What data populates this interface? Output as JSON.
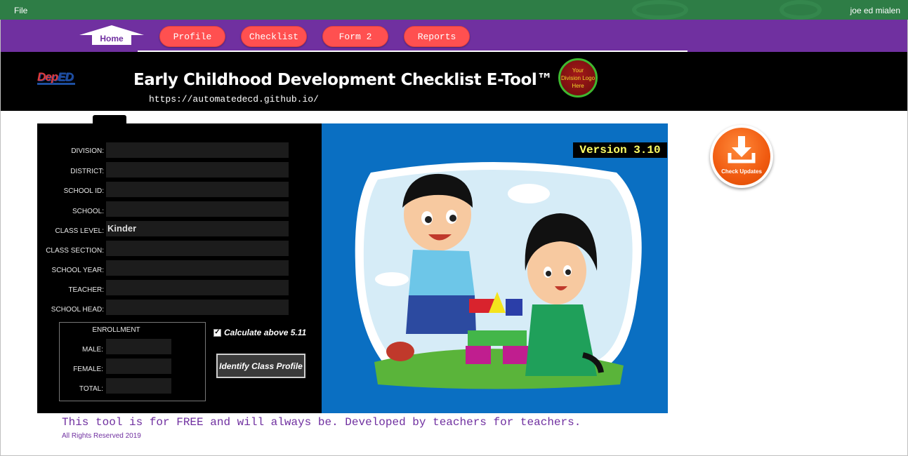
{
  "menubar": {
    "file_label": "File",
    "user_name": "joe ed mialen"
  },
  "nav": {
    "home_label": "Home",
    "items": [
      {
        "label": "Profile"
      },
      {
        "label": "Checklist"
      },
      {
        "label": "Form 2"
      },
      {
        "label": "Reports"
      }
    ]
  },
  "header": {
    "logo_text_a": "Dep",
    "logo_text_b": "ED",
    "title": "Early Childhood Development Checklist E-Tool™",
    "url": "https://automatedecd.github.io/",
    "division_logo_lines": [
      "Your",
      "Division Logo",
      "Here"
    ]
  },
  "form": {
    "fields": [
      {
        "label": "DIVISION:",
        "value": ""
      },
      {
        "label": "DISTRICT:",
        "value": ""
      },
      {
        "label": "SCHOOL ID:",
        "value": ""
      },
      {
        "label": "SCHOOL:",
        "value": ""
      },
      {
        "label": "CLASS LEVEL:",
        "value": "Kinder"
      },
      {
        "label": "CLASS SECTION:",
        "value": ""
      },
      {
        "label": "SCHOOL YEAR:",
        "value": ""
      },
      {
        "label": "TEACHER:",
        "value": ""
      },
      {
        "label": "SCHOOL HEAD:",
        "value": ""
      }
    ],
    "enrollment": {
      "title": "ENROLLMENT",
      "rows": [
        {
          "label": "MALE:",
          "value": ""
        },
        {
          "label": "FEMALE:",
          "value": ""
        },
        {
          "label": "TOTAL:",
          "value": ""
        }
      ]
    },
    "calculate_checkbox": {
      "label": "Calculate above 5.11",
      "checked": true,
      "check_glyph": "✓"
    },
    "identify_button": "Identify Class Profile"
  },
  "version_label": "Version 3.10",
  "check_updates_label": "Check Updates",
  "footer": {
    "message": "This tool is for FREE and will always be. Developed by teachers for teachers.",
    "rights": "All Rights Reserved 2019"
  },
  "colors": {
    "nav_bg": "#7030a0",
    "pill": "#ff5050",
    "top_strip": "#2e7d46",
    "illustration_bg": "#0a6fc2",
    "update_orange": "#f05a10"
  }
}
